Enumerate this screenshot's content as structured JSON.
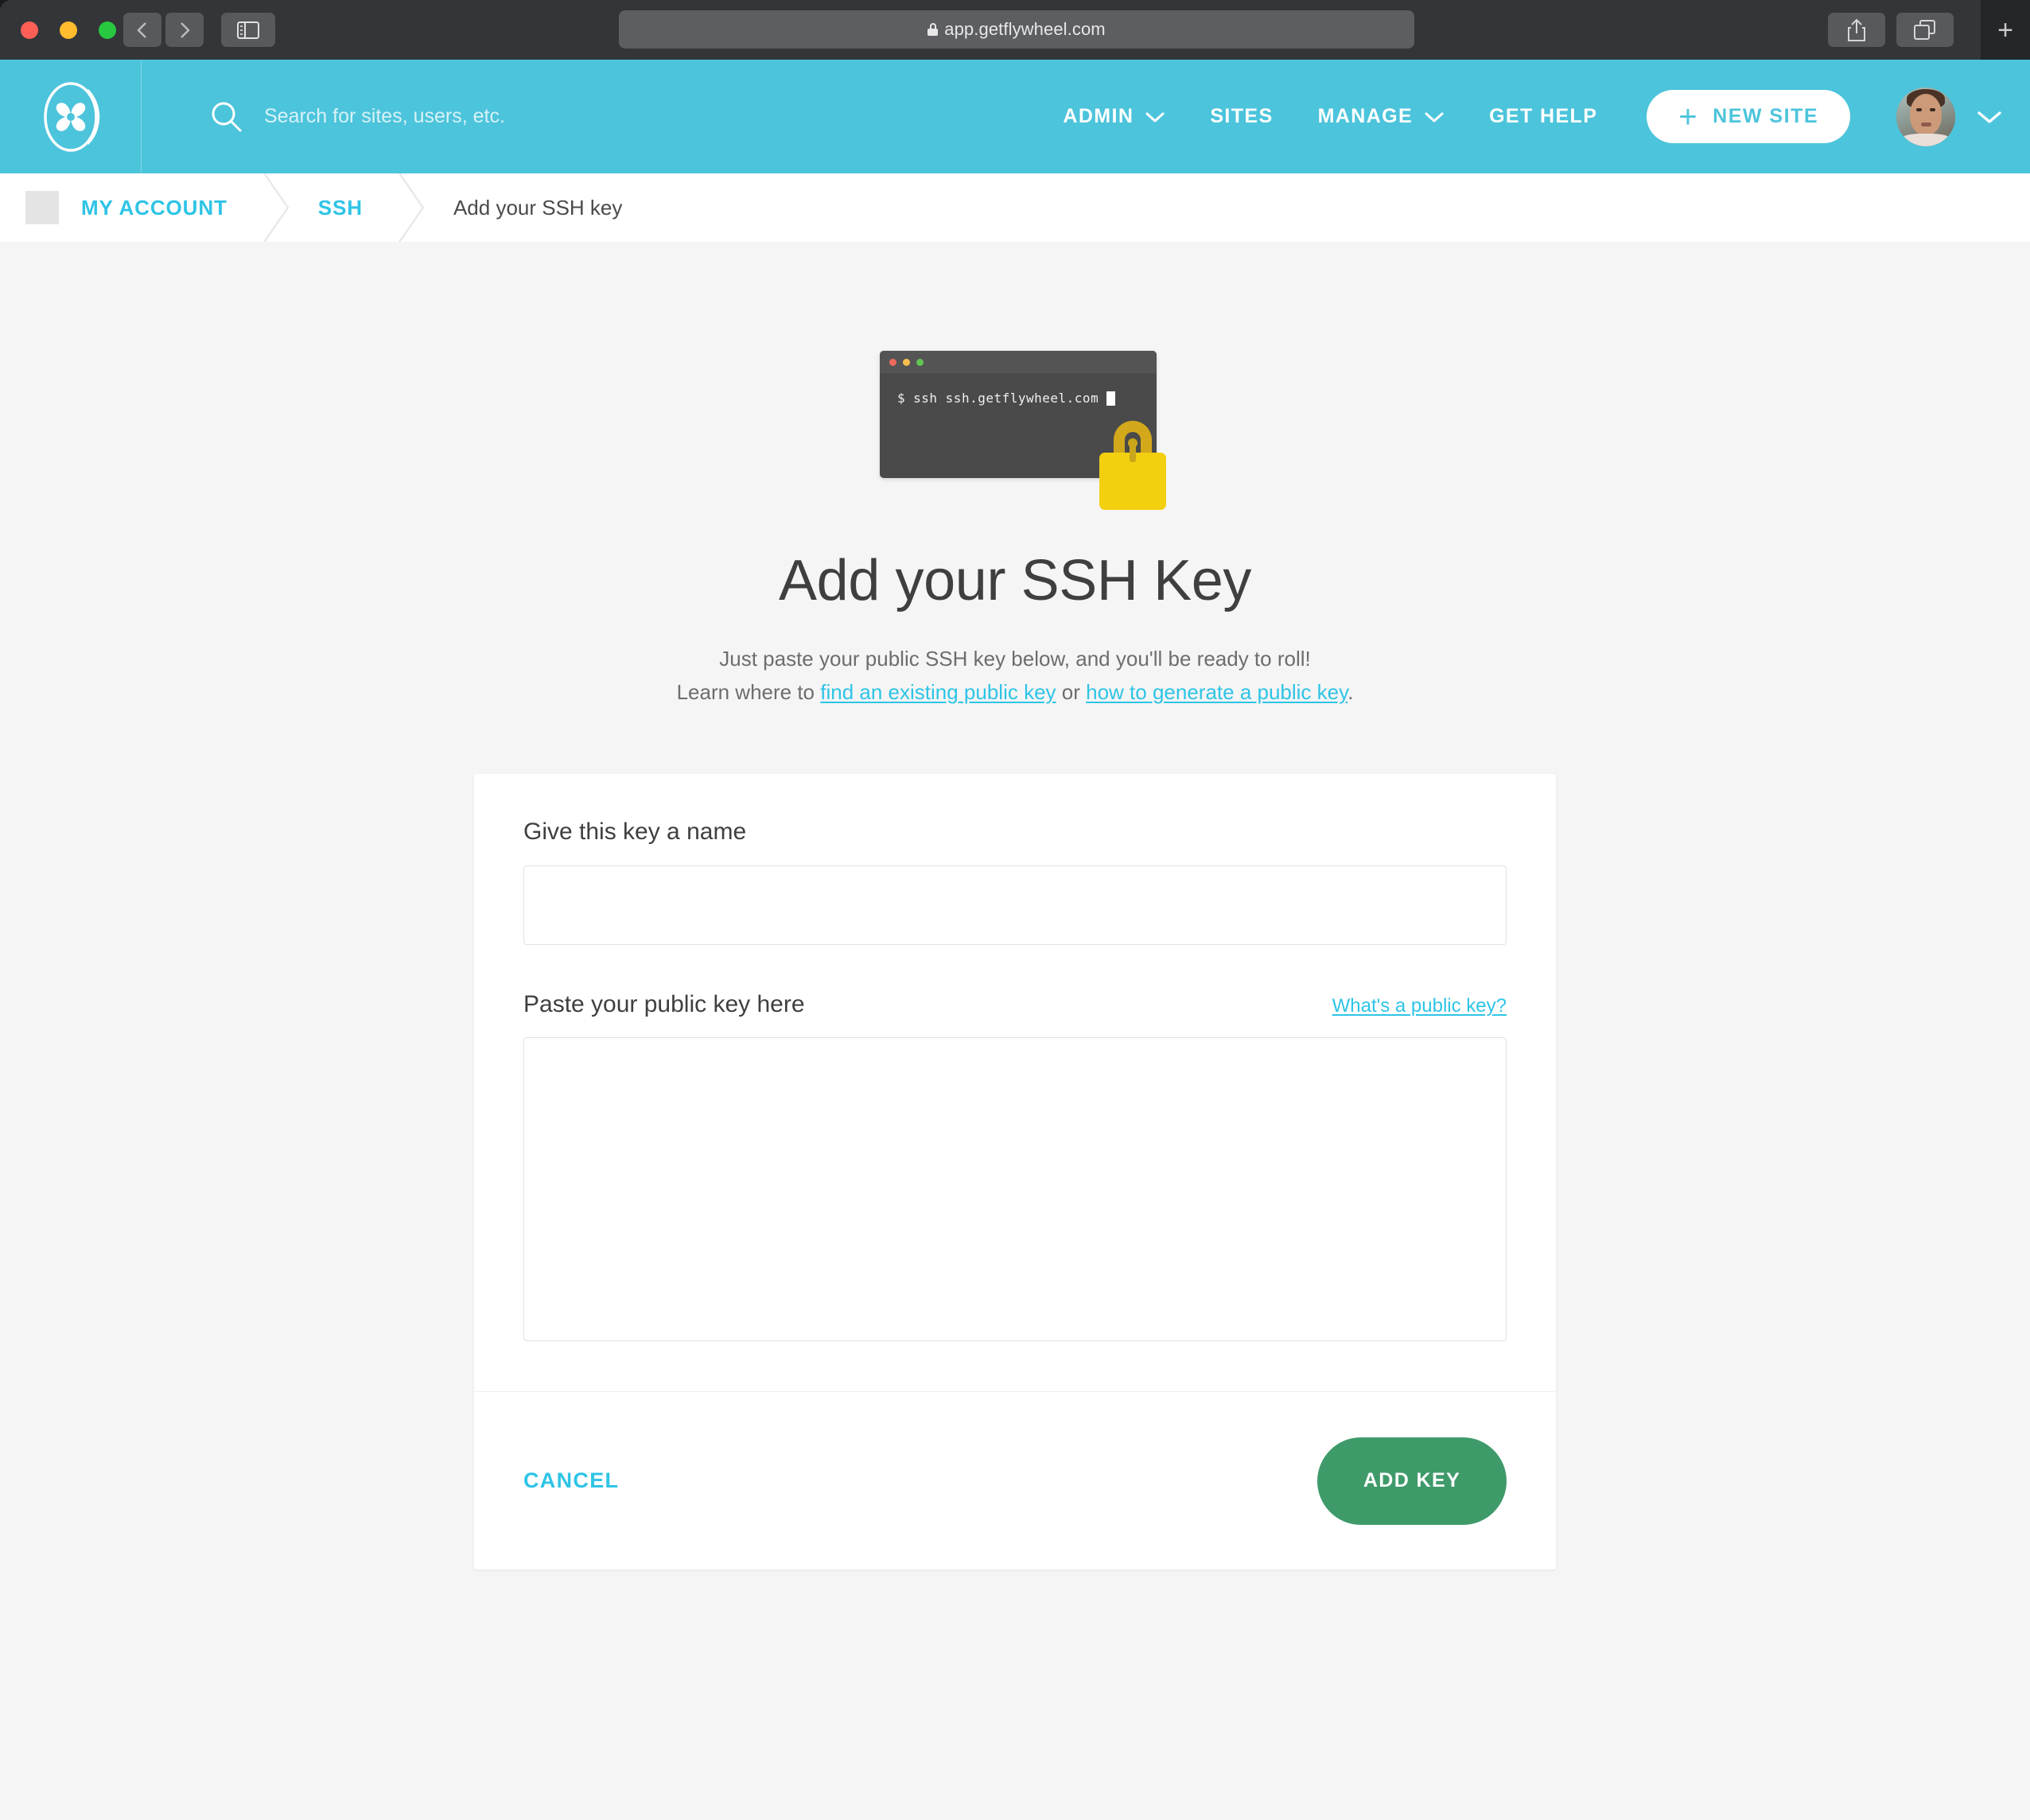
{
  "browser": {
    "url": "app.getflywheel.com",
    "lock_icon": "lock-icon",
    "back_icon": "chevron-left-icon",
    "forward_icon": "chevron-right-icon",
    "sidebar_icon": "sidebar-toggle-icon",
    "share_icon": "share-icon",
    "tabs_icon": "tab-overview-icon",
    "newtab_label": "+"
  },
  "topnav": {
    "logo_name": "flywheel-logo",
    "search_placeholder": "Search for sites, users, etc.",
    "search_icon": "search-icon",
    "links": [
      {
        "label": "ADMIN",
        "has_caret": true
      },
      {
        "label": "SITES",
        "has_caret": false
      },
      {
        "label": "MANAGE",
        "has_caret": true
      },
      {
        "label": "GET HELP",
        "has_caret": false
      }
    ],
    "new_site_label": "NEW SITE",
    "new_site_plus": "+",
    "avatar_name": "user-avatar",
    "avatar_caret": "chevron-down-icon"
  },
  "breadcrumb": {
    "items": [
      {
        "label": "MY ACCOUNT",
        "current": false
      },
      {
        "label": "SSH",
        "current": false
      },
      {
        "label": "Add your SSH key",
        "current": true
      }
    ]
  },
  "illustration": {
    "terminal_prompt": "$",
    "terminal_command": "ssh ssh.getflywheel.com",
    "lock_name": "padlock-icon"
  },
  "hero": {
    "title": "Add your SSH Key",
    "subtitle_line1": "Just paste your public SSH key below, and you'll be ready to roll!",
    "subtitle_prefix": "Learn where to ",
    "link1": "find an existing public key",
    "subtitle_mid": " or ",
    "link2": "how to generate a public key",
    "subtitle_suffix": "."
  },
  "form": {
    "name_label": "Give this key a name",
    "name_value": "",
    "name_placeholder": "",
    "key_label": "Paste your public key here",
    "key_help_link": "What's a public key?",
    "key_value": "",
    "key_placeholder": "",
    "cancel_label": "CANCEL",
    "submit_label": "ADD KEY"
  },
  "colors": {
    "brand_teal": "#4CC4DB",
    "link_teal": "#2EC4E6",
    "submit_green": "#3F9A6A",
    "page_bg": "#F5F5F5",
    "lock_yellow": "#F2D010"
  }
}
